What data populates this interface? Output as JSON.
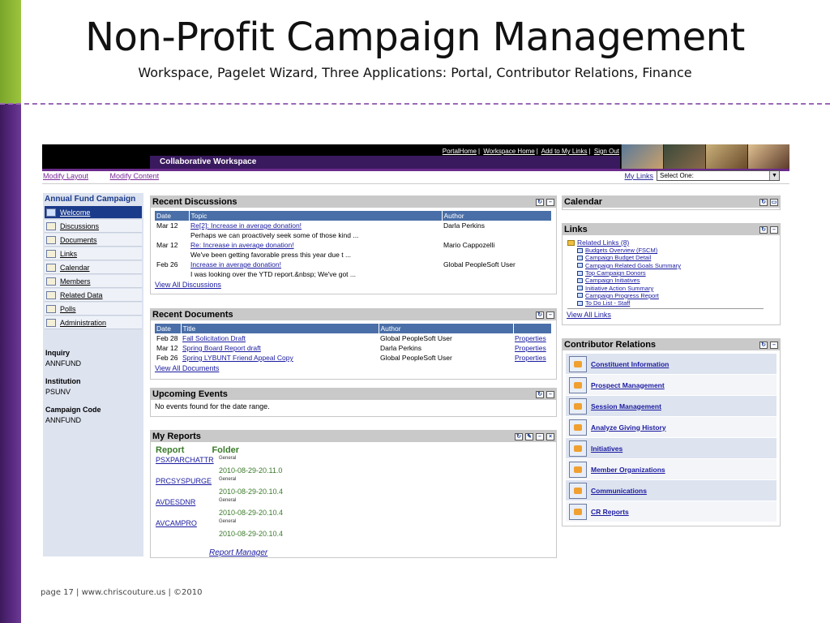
{
  "slide": {
    "title": "Non-Profit Campaign Management",
    "subtitle": "Workspace, Pagelet Wizard, Three Applications: Portal, Contributor Relations, Finance",
    "footer": "page 17 | www.chriscouture.us | ©2010"
  },
  "topbar": {
    "links": [
      "PortalHome",
      "Workspace Home",
      "Add to My Links",
      "Sign Out"
    ],
    "workspace_title": "Collaborative Workspace"
  },
  "toolbar": {
    "modify_layout": "Modify Layout",
    "modify_content": "Modify Content",
    "my_links_label": "My Links",
    "my_links_select": "Select One:"
  },
  "leftnav": {
    "header": "Annual Fund Campaign",
    "items": [
      {
        "label": "Welcome",
        "icon": "home-icon"
      },
      {
        "label": "Discussions",
        "icon": "speech-bubble-icon"
      },
      {
        "label": "Documents",
        "icon": "folder-icon"
      },
      {
        "label": "Links",
        "icon": "link-icon"
      },
      {
        "label": "Calendar",
        "icon": "calendar-icon"
      },
      {
        "label": "Members",
        "icon": "people-icon"
      },
      {
        "label": "Related Data",
        "icon": "table-icon"
      },
      {
        "label": "Polls",
        "icon": "poll-icon"
      },
      {
        "label": "Administration",
        "icon": "admin-icon"
      }
    ],
    "info": [
      {
        "key": "Inquiry",
        "value": "ANNFUND"
      },
      {
        "key": "Institution",
        "value": "PSUNV"
      },
      {
        "key": "Campaign Code",
        "value": "ANNFUND"
      }
    ]
  },
  "discussions": {
    "title": "Recent Discussions",
    "columns": [
      "Date",
      "Topic",
      "Author"
    ],
    "rows": [
      {
        "date": "Mar 12",
        "topic": "Re[2]: Increase in average donation!",
        "snippet": "Perhaps we can proactively seek some of those kind ...",
        "author": "Darla Perkins"
      },
      {
        "date": "Mar 12",
        "topic": "Re: Increase in average donation!",
        "snippet": "We've been getting favorable press this year due t ...",
        "author": "Mario Cappozelli"
      },
      {
        "date": "Feb 26",
        "topic": "Increase in average donation!",
        "snippet": "I was looking over the YTD report.&nbsp; We've got ...",
        "author": "Global PeopleSoft User"
      }
    ],
    "view_all": "View All Discussions"
  },
  "documents": {
    "title": "Recent Documents",
    "columns": [
      "Date",
      "Title",
      "Author",
      ""
    ],
    "rows": [
      {
        "date": "Feb 28",
        "title": "Fall Solicitation Draft",
        "author": "Global PeopleSoft User",
        "action": "Properties"
      },
      {
        "date": "Mar 12",
        "title": "Spring Board Report draft",
        "author": "Darla Perkins",
        "action": "Properties"
      },
      {
        "date": "Feb 26",
        "title": "Spring LYBUNT Friend Appeal Copy",
        "author": "Global PeopleSoft User",
        "action": "Properties"
      }
    ],
    "view_all": "View All Documents"
  },
  "events": {
    "title": "Upcoming Events",
    "message": "No events found for the date range."
  },
  "reports": {
    "title": "My Reports",
    "col_report": "Report",
    "col_folder": "Folder",
    "rows": [
      {
        "name": "PSXPARCHATTR",
        "folder": "General",
        "date": "2010-08-29-20.11.0"
      },
      {
        "name": "PRCSYSPURGE",
        "folder": "General",
        "date": "2010-08-29-20.10.4"
      },
      {
        "name": "AVDESDNR",
        "folder": "General",
        "date": "2010-08-29-20.10.4"
      },
      {
        "name": "AVCAMPRO",
        "folder": "General",
        "date": "2010-08-29-20.10.4"
      }
    ],
    "manager": "Report Manager"
  },
  "calendar": {
    "title": "Calendar"
  },
  "links": {
    "title": "Links",
    "group": "Related Links (8)",
    "items": [
      "Budgets Overview (FSCM)",
      "Campaign Budget Detail",
      "Campaign Related Goals Summary",
      "Top Campaign Donors",
      "Campaign Initiatives",
      "Initiative Action Summary",
      "Campaign Progress Report",
      "To Do List - Staff"
    ],
    "view_all": "View All Links"
  },
  "contributor": {
    "title": "Contributor Relations",
    "items": [
      "Constituent Information",
      "Prospect Management",
      "Session Management",
      "Analyze Giving History",
      "Initiatives",
      "Member Organizations",
      "Communications",
      "CR Reports"
    ]
  },
  "colors": {
    "accent_purple": "#3a1a5e",
    "table_header": "#4a6fa8",
    "link_blue": "#1a1aa0",
    "nav_active": "#1a3a8a"
  }
}
